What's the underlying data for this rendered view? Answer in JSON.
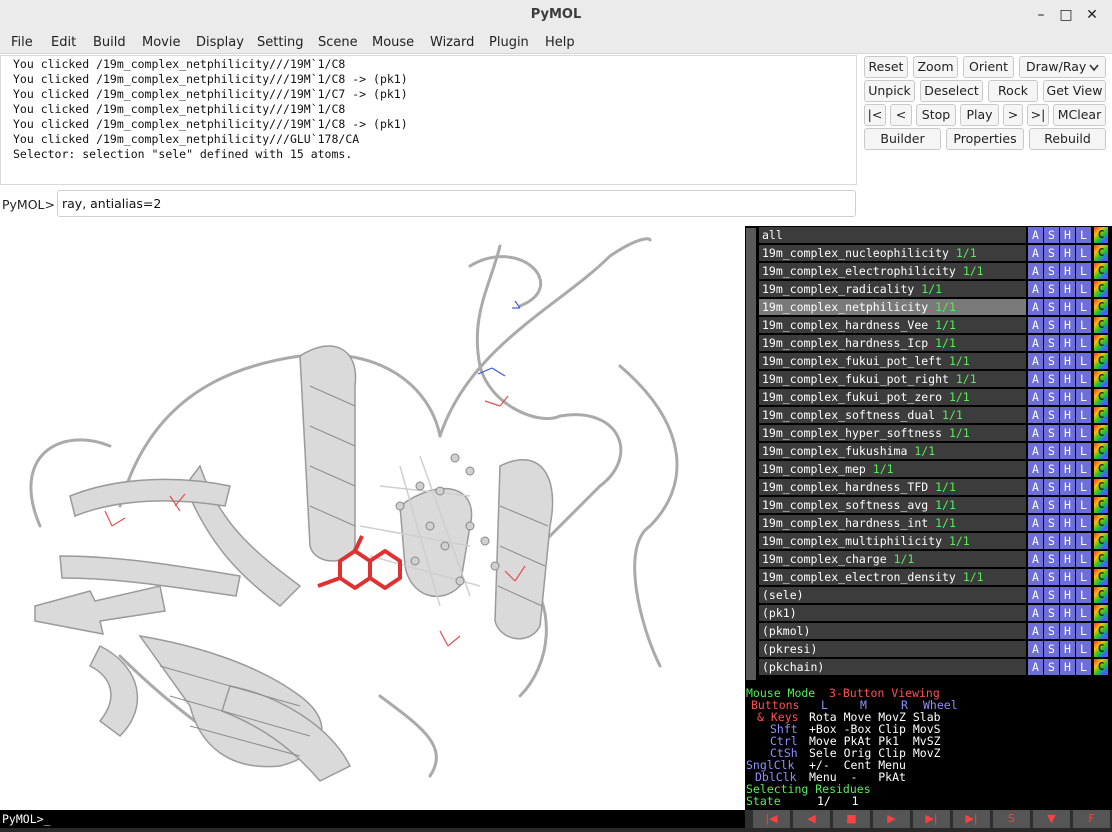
{
  "window": {
    "title": "PyMOL"
  },
  "controls": {
    "minimize": "–",
    "maximize": "□",
    "close": "✕"
  },
  "menu": [
    "File",
    "Edit",
    "Build",
    "Movie",
    "Display",
    "Setting",
    "Scene",
    "Mouse",
    "Wizard",
    "Plugin",
    "Help"
  ],
  "log": [
    "You clicked /19m_complex_netphilicity///19M`1/C8",
    "You clicked /19m_complex_netphilicity///19M`1/C8 -> (pk1)",
    "You clicked /19m_complex_netphilicity///19M`1/C7 -> (pk1)",
    "You clicked /19m_complex_netphilicity///19M`1/C8",
    "You clicked /19m_complex_netphilicity///19M`1/C8 -> (pk1)",
    "You clicked /19m_complex_netphilicity///GLU`178/CA",
    "Selector: selection \"sele\" defined with 15 atoms."
  ],
  "command": {
    "prompt": "PyMOL>",
    "value": "ray, antialias=2"
  },
  "buttons": {
    "row1": [
      "Reset",
      "Zoom",
      "Orient",
      "Draw/Ray"
    ],
    "row2": [
      "Unpick",
      "Deselect",
      "Rock",
      "Get View"
    ],
    "row3": [
      "|<",
      "<",
      "Stop",
      "Play",
      ">",
      ">|",
      "MClear"
    ],
    "row4": [
      "Builder",
      "Properties",
      "Rebuild"
    ]
  },
  "dropdown_icon": "chevron-down-icon",
  "objects": [
    {
      "name": "all",
      "count": ""
    },
    {
      "name": "19m_complex_nucleophilicity",
      "count": "1/1"
    },
    {
      "name": "19m_complex_electrophilicity",
      "count": "1/1"
    },
    {
      "name": "19m_complex_radicality",
      "count": "1/1"
    },
    {
      "name": "19m_complex_netphilicity",
      "count": "1/1",
      "selected": true
    },
    {
      "name": "19m_complex_hardness_Vee",
      "count": "1/1"
    },
    {
      "name": "19m_complex_hardness_Icp",
      "count": "1/1"
    },
    {
      "name": "19m_complex_fukui_pot_left",
      "count": "1/1"
    },
    {
      "name": "19m_complex_fukui_pot_right",
      "count": "1/1"
    },
    {
      "name": "19m_complex_fukui_pot_zero",
      "count": "1/1"
    },
    {
      "name": "19m_complex_softness_dual",
      "count": "1/1"
    },
    {
      "name": "19m_complex_hyper_softness",
      "count": "1/1"
    },
    {
      "name": "19m_complex_fukushima",
      "count": "1/1"
    },
    {
      "name": "19m_complex_mep",
      "count": "1/1"
    },
    {
      "name": "19m_complex_hardness_TFD",
      "count": "1/1"
    },
    {
      "name": "19m_complex_softness_avg",
      "count": "1/1"
    },
    {
      "name": "19m_complex_hardness_int",
      "count": "1/1"
    },
    {
      "name": "19m_complex_multiphilicity",
      "count": "1/1"
    },
    {
      "name": "19m_complex_charge",
      "count": "1/1"
    },
    {
      "name": "19m_complex_electron_density",
      "count": "1/1"
    },
    {
      "name": "(sele)",
      "count": ""
    },
    {
      "name": "(pk1)",
      "count": ""
    },
    {
      "name": "(pkmol)",
      "count": ""
    },
    {
      "name": "(pkresi)",
      "count": ""
    },
    {
      "name": "(pkchain)",
      "count": ""
    }
  ],
  "object_buttons": [
    "A",
    "S",
    "H",
    "L",
    "C"
  ],
  "mouse_info": {
    "header_a": "Mouse Mode ",
    "header_b": "3-Button Viewing",
    "buttons_label": "Buttons",
    "buttons_cols": [
      "L",
      "M",
      "R",
      "Wheel"
    ],
    "rows": [
      {
        "label": "& Keys",
        "vals": "Rota Move MovZ Slab"
      },
      {
        "label": "Shft",
        "vals": "+Box -Box Clip MovS"
      },
      {
        "label": "Ctrl",
        "vals": "Move PkAt Pk1  MvSZ"
      },
      {
        "label": "CtSh",
        "vals": "Sele Orig Clip MovZ"
      },
      {
        "label": "SnglClk",
        "vals": "+/-  Cent Menu"
      },
      {
        "label": "DblClk",
        "vals": "Menu  -   PkAt"
      }
    ],
    "selecting": "Selecting Residues",
    "state_label": "State",
    "state_value": "1/   1"
  },
  "vcr_buttons": [
    "|◀",
    "◀",
    "■",
    "▶",
    "▶|",
    "▶|",
    "S",
    "▼",
    "F"
  ],
  "bottom_cmd": "PyMOL>_",
  "colors": {
    "viewer_bg": "#ffffff",
    "panel_bg": "#000000",
    "object_row": "#3c3c3c",
    "object_btn": "#6e6ed8",
    "count_green": "#55ee55",
    "ligand_red": "#e03030"
  }
}
